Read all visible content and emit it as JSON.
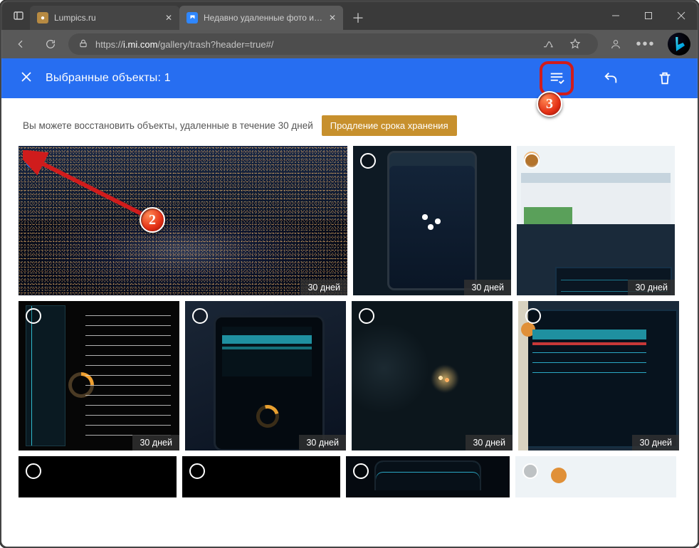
{
  "browser": {
    "tabs": [
      {
        "title": "Lumpics.ru",
        "active": false
      },
      {
        "title": "Недавно удаленные фото и вид",
        "active": true
      }
    ],
    "url_prefix": "https://",
    "url_host": "i.mi.com",
    "url_path": "/gallery/trash?header=true#/"
  },
  "appbar": {
    "title": "Выбранные объекты: 1",
    "actions": {
      "select_all": "select-all",
      "undo": "undo",
      "delete": "delete"
    }
  },
  "info": {
    "text": "Вы можете восстановить объекты, удаленные в течение 30 дней",
    "extend_label": "Продление срока хранения"
  },
  "days_label": "30 дней",
  "annotations": {
    "step2": "2",
    "step3": "3"
  },
  "thumbs": [
    {
      "id": 1,
      "selected": true,
      "days": true
    },
    {
      "id": 2,
      "selected": false,
      "days": true
    },
    {
      "id": 3,
      "selected": false,
      "days": true
    },
    {
      "id": 4,
      "selected": false,
      "days": true
    },
    {
      "id": 5,
      "selected": false,
      "days": true
    },
    {
      "id": 6,
      "selected": false,
      "days": true
    },
    {
      "id": 7,
      "selected": false,
      "days": true
    },
    {
      "id": 8,
      "selected": false,
      "days": false
    },
    {
      "id": 9,
      "selected": false,
      "days": false
    },
    {
      "id": 10,
      "selected": false,
      "days": false
    },
    {
      "id": 11,
      "selected": false,
      "days": false
    }
  ]
}
